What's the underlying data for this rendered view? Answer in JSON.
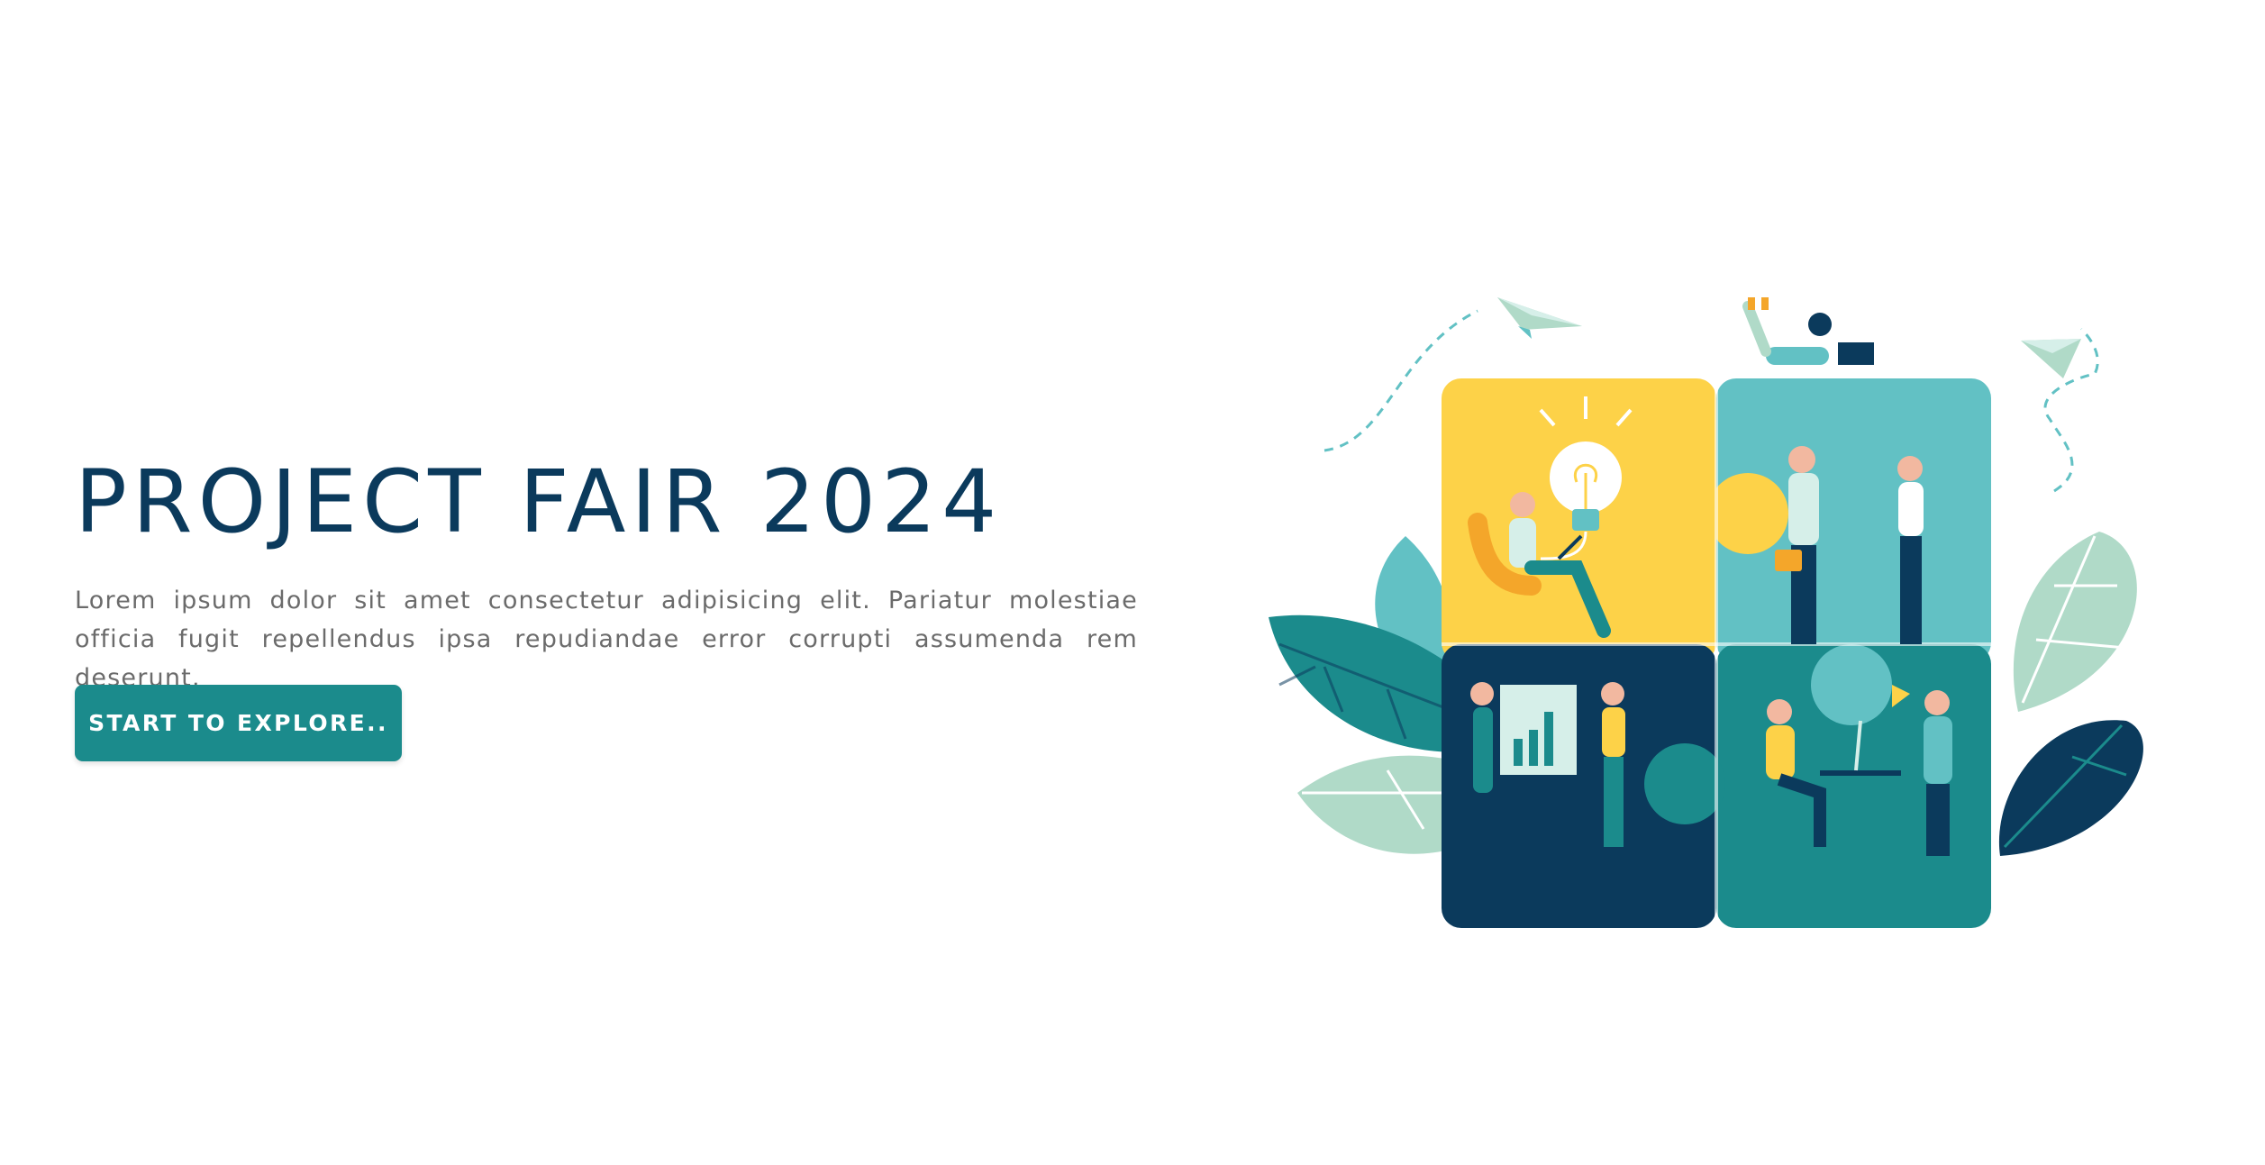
{
  "hero": {
    "title": "PROJECT FAIR 2024",
    "description": "Lorem ipsum dolor sit amet consectetur adipisicing elit. Pariatur molestiae officia fugit repellendus ipsa repudiandae error corrupti assumenda rem deserunt.",
    "cta_label": "START TO EXPLORE.."
  },
  "illustration": {
    "icon": "teamwork-puzzle-illustration",
    "colors": {
      "yellow": "#fdd248",
      "light_teal": "#62c1c4",
      "navy": "#0b3a5c",
      "teal": "#1b8b8c",
      "mint": "#b0dac8"
    }
  },
  "theme": {
    "title_color": "#0b3a5c",
    "text_color": "#6b6b6b",
    "accent": "#1b8b8c",
    "background": "#ffffff"
  }
}
